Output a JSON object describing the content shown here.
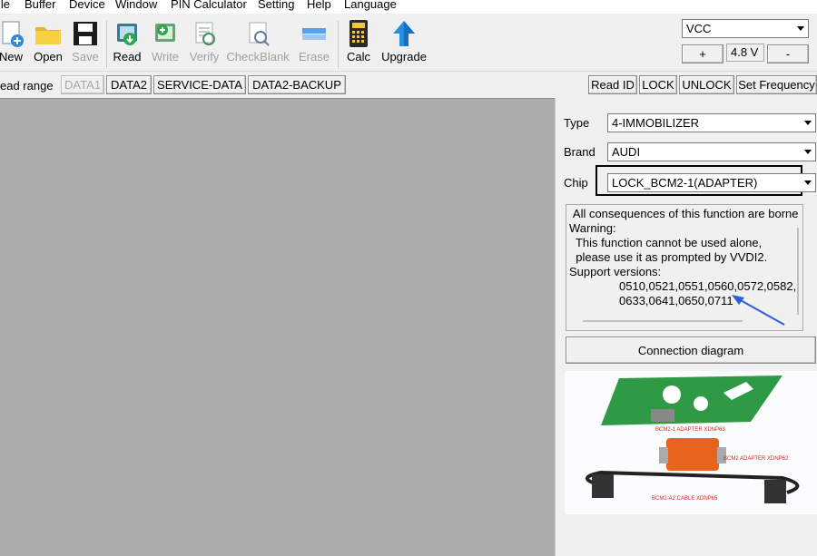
{
  "menu": {
    "items": [
      "ile",
      "Buffer",
      "Device",
      "Window",
      "PIN Calculator",
      "Setting",
      "Help",
      "Language"
    ]
  },
  "toolbar": {
    "buttons": [
      {
        "label": "New",
        "enabled": true,
        "icon": "new-file-icon"
      },
      {
        "label": "Open",
        "enabled": true,
        "icon": "folder-icon"
      },
      {
        "label": "Save",
        "enabled": false,
        "icon": "floppy-disk-icon"
      },
      {
        "label": "Read",
        "enabled": true,
        "icon": "read-chip-icon"
      },
      {
        "label": "Write",
        "enabled": false,
        "icon": "write-chip-icon"
      },
      {
        "label": "Verify",
        "enabled": false,
        "icon": "verify-icon"
      },
      {
        "label": "CheckBlank",
        "enabled": false,
        "icon": "check-blank-icon"
      },
      {
        "label": "Erase",
        "enabled": false,
        "icon": "erase-icon"
      },
      {
        "label": "Calc",
        "enabled": true,
        "icon": "calculator-icon"
      },
      {
        "label": "Upgrade",
        "enabled": true,
        "icon": "upgrade-arrow-icon"
      }
    ]
  },
  "vcc": {
    "selected": "VCC",
    "plus_label": "+",
    "voltage": "4.8 V",
    "minus_label": "-"
  },
  "tabs": {
    "range_label": "ead range",
    "items": [
      "DATA1",
      "DATA2",
      "SERVICE-DATA",
      "DATA2-BACKUP"
    ],
    "active": "DATA1",
    "actions": [
      "Read ID",
      "LOCK",
      "UNLOCK",
      "Set Frequency"
    ]
  },
  "panel": {
    "type_label": "Type",
    "type_value": "4-IMMOBILIZER",
    "brand_label": "Brand",
    "brand_value": "AUDI",
    "chip_label": "Chip",
    "chip_value": "LOCK_BCM2-1(ADAPTER)",
    "info_lines": [
      " All consequences of this function are borne",
      "Warning:",
      "  This function cannot be used alone,",
      "  please use it as prompted by VVDI2.",
      "Support versions:",
      "0510,0521,0551,0560,0572,0582,",
      "0633,0641,0650,0711"
    ],
    "connection_button": "Connection diagram",
    "diagram_labels": [
      "BCM2-1 ADAPTER  XDNP63",
      "BCM2 ADAPTER  XDNP62",
      "BCM2-A2 CABLE XDNP65"
    ]
  },
  "colors": {
    "workspace": "#ababab",
    "annotation_arrow": "#2e5fd8",
    "pcb_green": "#2f9a45",
    "adapter_orange": "#e8641c"
  }
}
